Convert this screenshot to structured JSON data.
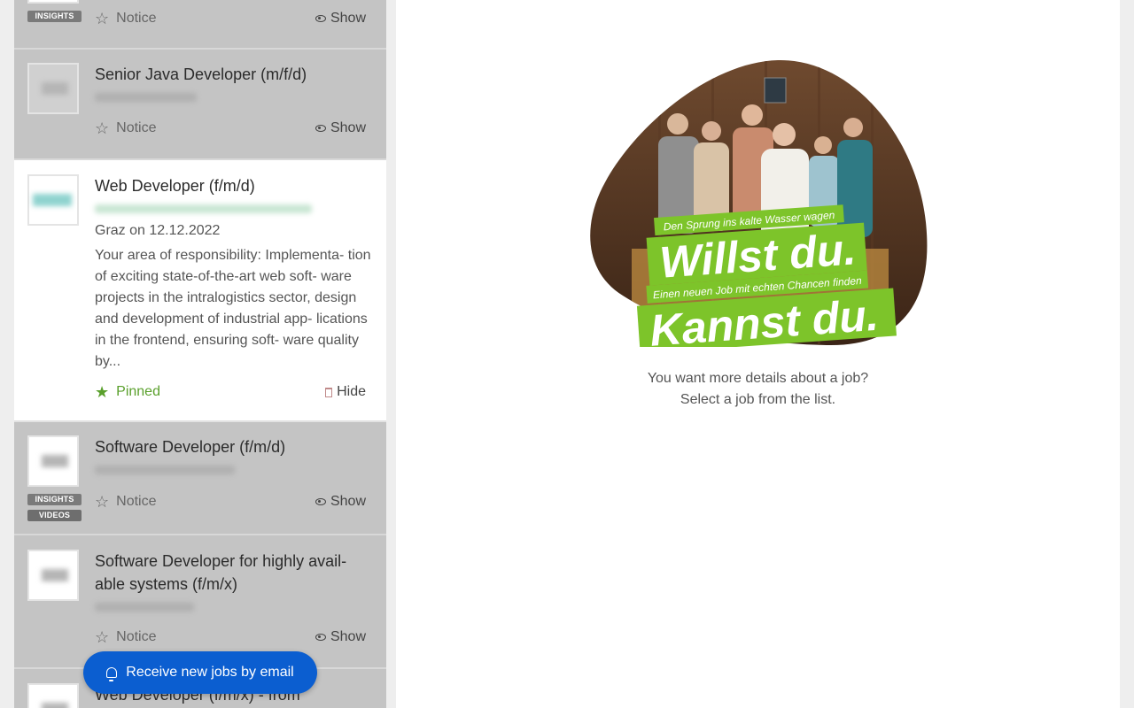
{
  "jobs": [
    {
      "title": "",
      "badges": [
        "INSIGHTS"
      ],
      "action": "Notice",
      "secondary": "Show"
    },
    {
      "title": "Senior Java Developer (m/f/d)",
      "action": "Notice",
      "secondary": "Show"
    },
    {
      "title": "Web Developer (f/m/d)",
      "location_date": "Graz on 12.12.2022",
      "description": "Your area of responsibility: Implementa- tion of exciting state-of-the-art web soft- ware projects in the intralogistics sector, design and development of industrial app- lications in the frontend, ensuring soft- ware quality by...",
      "action": "Pinned",
      "secondary": "Hide"
    },
    {
      "title": "Software Developer (f/m/d)",
      "badges": [
        "INSIGHTS",
        "VIDEOS"
      ],
      "action": "Notice",
      "secondary": "Show"
    },
    {
      "title": "Software Developer for highly avail- able systems (f/m/x)",
      "action": "Notice",
      "secondary": "Show"
    },
    {
      "title": "Web Developer (f/m/x) - from"
    }
  ],
  "email_button": {
    "label": "Receive new jobs by email",
    "icon": "bell-icon"
  },
  "hero": {
    "tagline1": "Den Sprung ins kalte Wasser wagen",
    "headline1": "Willst du.",
    "tagline2": "Einen neuen Job mit echten Chancen finden",
    "headline2": "Kannst du."
  },
  "empty_state": {
    "line1": "You want more details about a job?",
    "line2": "Select a job from the list."
  },
  "colors": {
    "accent": "#0b5ed0",
    "pinned": "#5aa02c",
    "hero_green": "#7dc42a"
  }
}
